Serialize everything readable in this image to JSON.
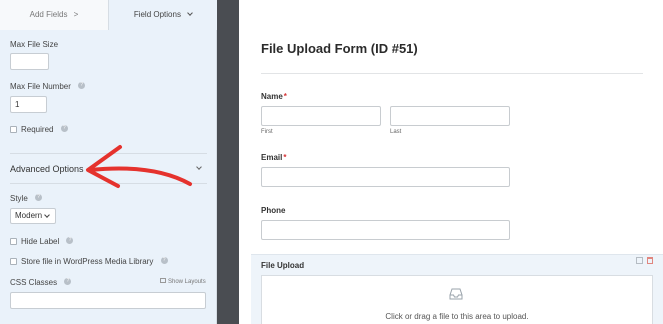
{
  "tabs": {
    "add_fields": "Add Fields",
    "field_options": "Field Options"
  },
  "field_options": {
    "max_file_size_label": "Max File Size",
    "max_file_size_value": "",
    "max_file_number_label": "Max File Number",
    "max_file_number_value": "1",
    "required_label": "Required",
    "advanced_options_label": "Advanced Options",
    "style_label": "Style",
    "style_value": "Modern",
    "hide_label_label": "Hide Label",
    "store_media_label": "Store file in WordPress Media Library",
    "css_classes_label": "CSS Classes",
    "show_layouts_label": "Show Layouts",
    "css_classes_value": ""
  },
  "preview": {
    "form_title": "File Upload Form (ID #51)",
    "name_label": "Name",
    "first_sublabel": "First",
    "last_sublabel": "Last",
    "email_label": "Email",
    "phone_label": "Phone",
    "file_upload_label": "File Upload",
    "dropzone_text": "Click or drag a file to this area to upload.",
    "required_marker": "*"
  },
  "colors": {
    "panel_bg": "#eaf2fa",
    "gutter_bg": "#4a4d52",
    "required": "#d63638",
    "annotation_arrow": "#e5322d"
  }
}
